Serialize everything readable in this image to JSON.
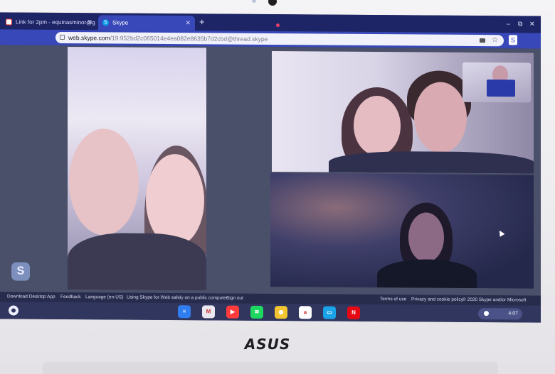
{
  "browser": {
    "tabs": [
      {
        "label": "Link for 2pm - equinasminor@g",
        "icon": "gmail-icon",
        "active": false
      },
      {
        "label": "Skype",
        "icon": "skype-icon",
        "active": true
      }
    ],
    "new_tab": "+",
    "window_controls": [
      "–",
      "⧉",
      "✕"
    ],
    "url_host": "web.skype.com",
    "url_path": "/19:952bd2c065014e4ea082e8635b7d2cbd@thread.skype",
    "extension_label": "S"
  },
  "skype": {
    "logo_label": "S",
    "footer_left": [
      "Download Desktop App",
      "Feedback",
      "Language (en-US)",
      "Using Skype for Web safely on a public computer",
      "Sign out"
    ],
    "footer_right": [
      "Terms of use",
      "Privacy and cookie policy",
      "© 2020 Skype and/or Microsoft"
    ]
  },
  "shelf": {
    "apps": [
      {
        "name": "docs-icon",
        "color": "#2f7df0",
        "glyph": "≡"
      },
      {
        "name": "gmail-icon",
        "color": "#e8e8ee",
        "glyph": "M"
      },
      {
        "name": "youtube-icon",
        "color": "#ff3b3b",
        "glyph": "▶"
      },
      {
        "name": "spotify-icon",
        "color": "#1ed760",
        "glyph": "≋"
      },
      {
        "name": "chrome-icon",
        "color": "#f2c530",
        "glyph": "◉"
      },
      {
        "name": "amazon-icon",
        "color": "#ffffff",
        "glyph": "a"
      },
      {
        "name": "files-icon",
        "color": "#1aa3e8",
        "glyph": "▭"
      },
      {
        "name": "netflix-icon",
        "color": "#e50914",
        "glyph": "N"
      }
    ],
    "time": "4:07"
  },
  "device": {
    "brand": "ASUS"
  }
}
